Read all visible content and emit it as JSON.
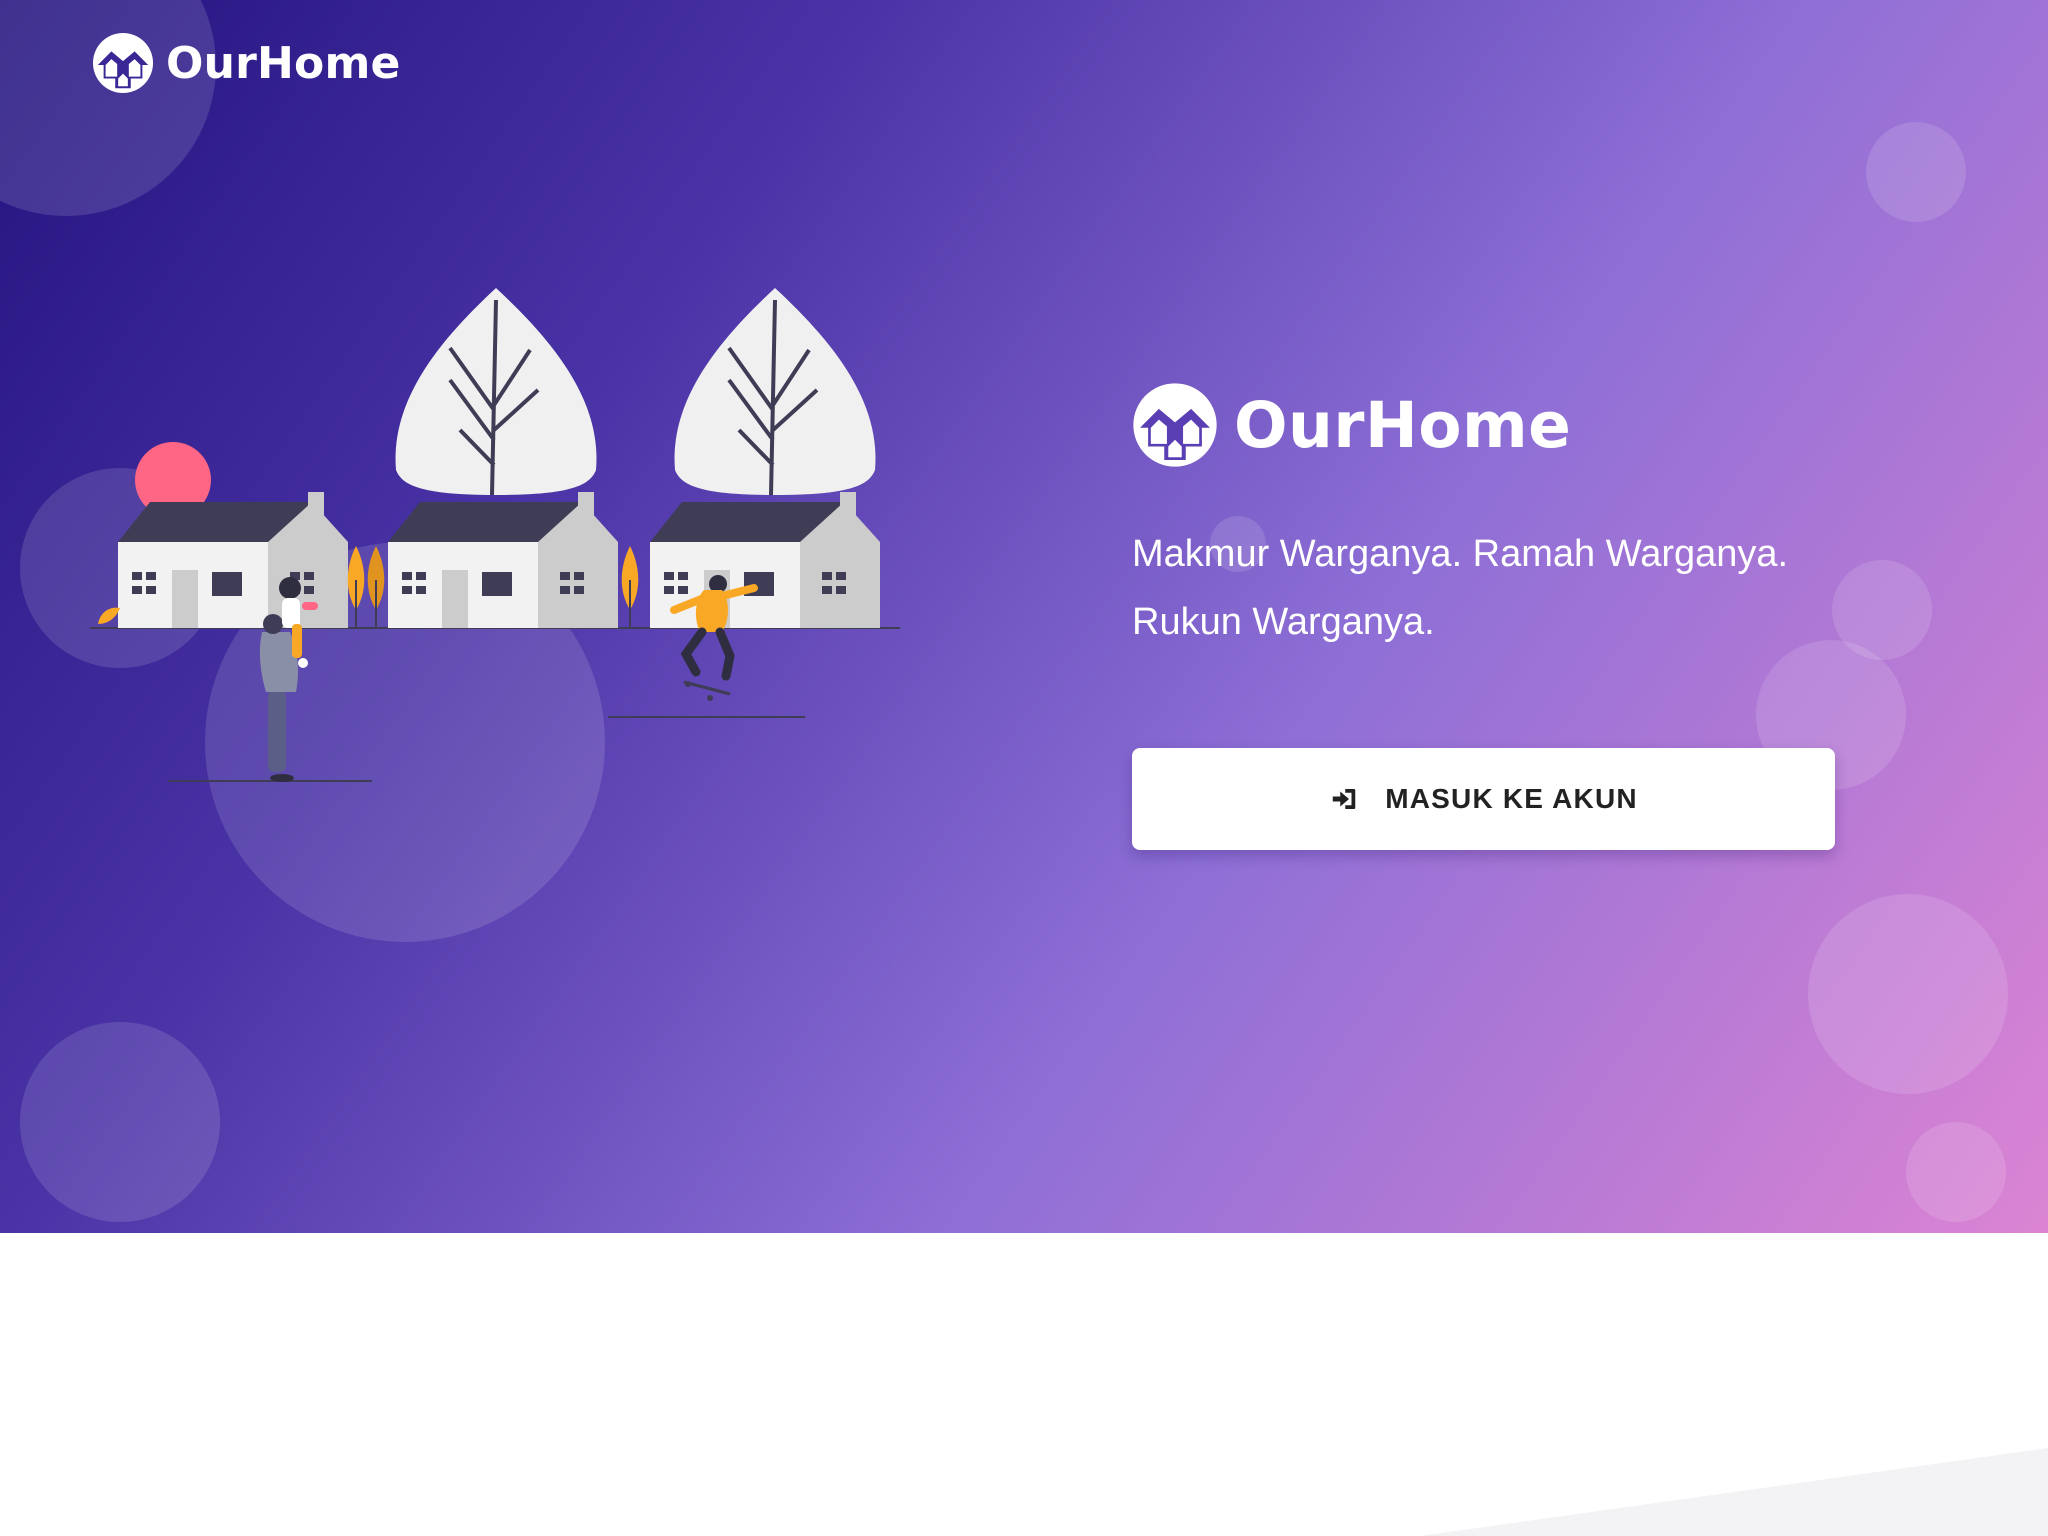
{
  "nav": {
    "brand_name": "OurHome"
  },
  "hero": {
    "brand_title": "OurHome",
    "tagline_line1": "Makmur Warganya. Ramah Warganya.",
    "tagline_line2": "Rukun Warganya.",
    "login_button_label": "MASUK KE AKUN",
    "login_button_icon": "sign-in-icon"
  },
  "colors": {
    "gradient_start": "#24137f",
    "gradient_end": "#dc84d4",
    "button_background": "#ffffff",
    "button_text": "#222222"
  }
}
